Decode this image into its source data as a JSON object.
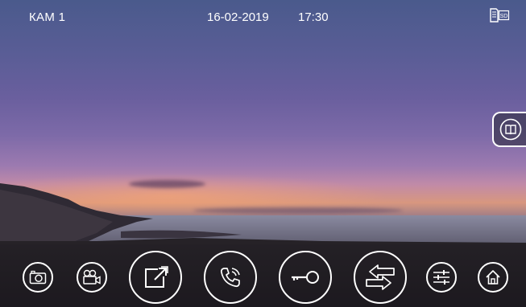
{
  "header": {
    "camera_label": "КАМ 1",
    "date": "16-02-2019",
    "time": "17:30",
    "sd_label": "SD"
  },
  "icons": {
    "sd_card": "sd-card-icon",
    "gallery": "book-icon",
    "snapshot": "camera-icon",
    "record": "video-camera-icon",
    "fullscreen": "expand-icon",
    "call": "phone-icon",
    "unlock": "key-icon",
    "switch": "swap-arrows-icon",
    "settings": "sliders-icon",
    "home": "home-icon"
  },
  "colors": {
    "foreground": "#ffffff"
  }
}
